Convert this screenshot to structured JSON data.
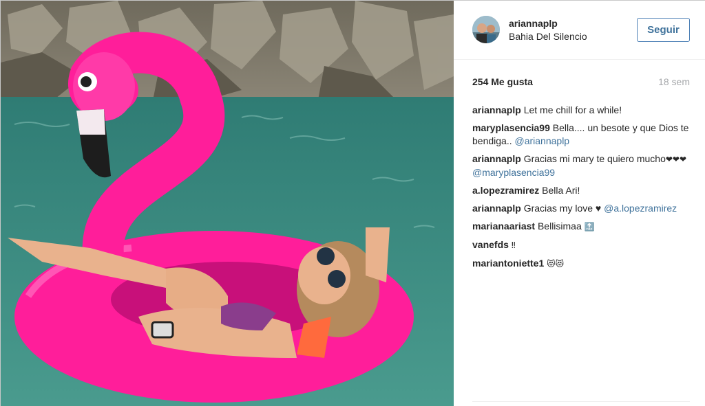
{
  "post": {
    "username": "ariannaplp",
    "location": "Bahia Del Silencio",
    "follow_label": "Seguir",
    "likes": "254 Me gusta",
    "time_ago": "18 sem"
  },
  "comments": [
    {
      "user": "ariannaplp",
      "text": "Let me chill for a while!",
      "mention": "",
      "emoji": ""
    },
    {
      "user": "maryplasencia99",
      "text": "Bella.... un besote y que Dios te bendiga..",
      "mention": "@ariannaplp",
      "emoji": ""
    },
    {
      "user": "ariannaplp",
      "text": "Gracias mi mary te quiero mucho",
      "emoji": "❤❤❤",
      "mention": "@maryplasencia99"
    },
    {
      "user": "a.lopezramirez",
      "text": "Bella Ari!",
      "mention": "",
      "emoji": ""
    },
    {
      "user": "ariannaplp",
      "text": "Gracias my love ♥",
      "mention": "@a.lopezramirez",
      "emoji": ""
    },
    {
      "user": "marianaariast",
      "text": "Bellisimaa",
      "emoji": "🔝",
      "mention": ""
    },
    {
      "user": "vanefds",
      "text": "",
      "emoji": "‼",
      "mention": ""
    },
    {
      "user": "mariantoniette1",
      "text": "",
      "emoji": "😻😻",
      "mention": ""
    }
  ],
  "colors": {
    "link": "#3f729b",
    "flamingo": "#ff1e9a",
    "water": "#3f8f86",
    "muted": "#a5a7aa"
  },
  "icons": {
    "avatar": "user-avatar-photo"
  }
}
